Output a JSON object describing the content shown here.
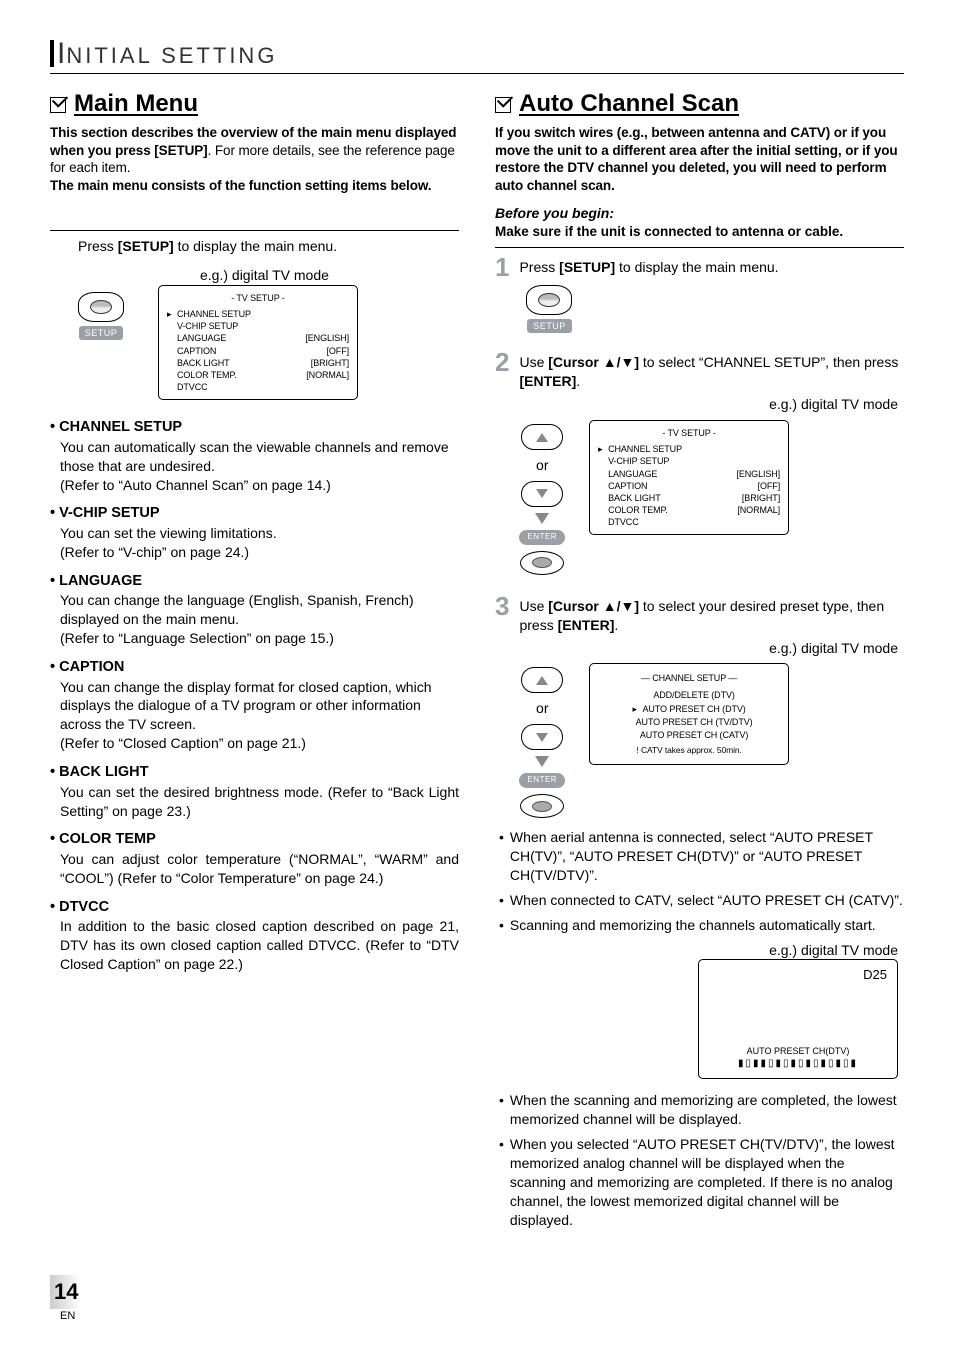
{
  "page": {
    "header_i": "I",
    "header_rest": "NITIAL  SETTING",
    "number": "14",
    "lang": "EN"
  },
  "left": {
    "section_title": "Main Menu",
    "intro_line1": "This section describes the overview of the main menu displayed when you press ",
    "intro_setup": "[SETUP]",
    "intro_line2": ". For more details, see the reference page for each item.",
    "intro_line3": "The main menu consists of the function setting items below.",
    "step_text_a": "Press ",
    "step_text_b": "[SETUP]",
    "step_text_c": " to display the main menu.",
    "eg_label": "e.g.) digital TV mode",
    "setup_label": "SETUP",
    "osd": {
      "title": "-   TV  SETUP   -",
      "rows": [
        {
          "arrow": "▸",
          "label": "CHANNEL  SETUP",
          "value": ""
        },
        {
          "arrow": "",
          "label": "V-CHIP  SETUP",
          "value": ""
        },
        {
          "arrow": "",
          "label": "LANGUAGE",
          "value": "[ENGLISH]"
        },
        {
          "arrow": "",
          "label": "CAPTION",
          "value": "[OFF]"
        },
        {
          "arrow": "",
          "label": "BACK  LIGHT",
          "value": "[BRIGHT]"
        },
        {
          "arrow": "",
          "label": "COLOR  TEMP.",
          "value": "[NORMAL]"
        },
        {
          "arrow": "",
          "label": "DTVCC",
          "value": ""
        }
      ]
    },
    "items": [
      {
        "title": "• CHANNEL SETUP",
        "text": "You can automatically scan the viewable channels and remove those that are undesired.",
        "ref": "(Refer to “Auto Channel Scan” on page 14.)",
        "justify": false
      },
      {
        "title": "• V-CHIP SETUP",
        "text": "You can set the viewing limitations.",
        "ref": "(Refer to “V-chip” on page 24.)",
        "justify": false
      },
      {
        "title": "• LANGUAGE",
        "text": "You can change the language (English, Spanish, French) displayed on the main menu.",
        "ref": "(Refer to “Language Selection” on page 15.)",
        "justify": false
      },
      {
        "title": "• CAPTION",
        "text": "You can change the display format for closed caption, which displays the dialogue of a TV program or other information across the TV screen.",
        "ref": "(Refer to “Closed Caption” on page 21.)",
        "justify": false
      },
      {
        "title": "• BACK LIGHT",
        "text": "You can set the desired brightness mode. (Refer to “Back Light Setting” on page 23.)",
        "ref": "",
        "justify": true
      },
      {
        "title": "• COLOR TEMP",
        "text": "You can adjust color temperature (“NORMAL”, “WARM” and “COOL”) (Refer to “Color Temperature” on page 24.)",
        "ref": "",
        "justify": true
      },
      {
        "title": "• DTVCC",
        "text": "In addition to the basic closed caption described on page 21, DTV has its own closed caption called DTVCC. (Refer to “DTV Closed Caption” on page 22.)",
        "ref": "",
        "justify": true
      }
    ]
  },
  "right": {
    "section_title": "Auto Channel Scan",
    "intro": "If you switch wires (e.g., between antenna and CATV) or if you move the unit to a different area after the initial setting, or if you restore the DTV channel you deleted, you will need to perform auto channel scan.",
    "before_label": "Before you begin:",
    "before_text": "Make sure if the unit is connected to antenna or cable.",
    "step1_a": "Press ",
    "step1_b": "[SETUP]",
    "step1_c": " to display the main menu.",
    "setup_label": "SETUP",
    "step2_a": "Use ",
    "step2_b": "[Cursor ▲/▼]",
    "step2_c": " to select “CHANNEL SETUP”, then press ",
    "step2_d": "[ENTER]",
    "step2_e": ".",
    "eg_label": "e.g.) digital TV mode",
    "or": "or",
    "enter_label": "ENTER",
    "osd_tv": {
      "title": "-   TV  SETUP   -",
      "rows": [
        {
          "arrow": "▸",
          "label": "CHANNEL  SETUP",
          "value": ""
        },
        {
          "arrow": "",
          "label": "V-CHIP  SETUP",
          "value": ""
        },
        {
          "arrow": "",
          "label": "LANGUAGE",
          "value": "[ENGLISH]"
        },
        {
          "arrow": "",
          "label": "CAPTION",
          "value": "[OFF]"
        },
        {
          "arrow": "",
          "label": "BACK  LIGHT",
          "value": "[BRIGHT]"
        },
        {
          "arrow": "",
          "label": "COLOR  TEMP.",
          "value": "[NORMAL]"
        },
        {
          "arrow": "",
          "label": "DTVCC",
          "value": ""
        }
      ]
    },
    "step3_a": "Use ",
    "step3_b": "[Cursor ▲/▼]",
    "step3_c": " to select your desired preset type, then press ",
    "step3_d": "[ENTER]",
    "step3_e": ".",
    "osd_channel": {
      "title": "—  CHANNEL SETUP  —",
      "lines": [
        {
          "arrow": "",
          "text": "ADD/DELETE (DTV)"
        },
        {
          "arrow": "▸",
          "text": "AUTO PRESET CH (DTV)"
        },
        {
          "arrow": "",
          "text": "AUTO PRESET CH (TV/DTV)"
        },
        {
          "arrow": "",
          "text": "AUTO PRESET CH (CATV)"
        }
      ],
      "note": "! CATV takes approx. 50min."
    },
    "bullets1": [
      "When aerial antenna is connected, select “AUTO PRESET CH(TV)”, “AUTO PRESET CH(DTV)” or “AUTO PRESET CH(TV/DTV)”.",
      "When connected to CATV, select “AUTO PRESET CH (CATV)”.",
      "Scanning and memorizing the channels automatically start."
    ],
    "osd_scan": {
      "channel": "D25",
      "label": "AUTO PRESET CH(DTV)",
      "bars": "▮▯▮▮▯▮▯▮▯▮▯▮▯▮▯▮"
    },
    "bullets2": [
      "When the scanning and memorizing are completed, the lowest memorized channel will be displayed.",
      "When you selected “AUTO PRESET CH(TV/DTV)”, the lowest memorized analog channel will be displayed when the scanning and memorizing are completed. If there is no analog channel, the lowest memorized digital channel will be displayed."
    ]
  }
}
